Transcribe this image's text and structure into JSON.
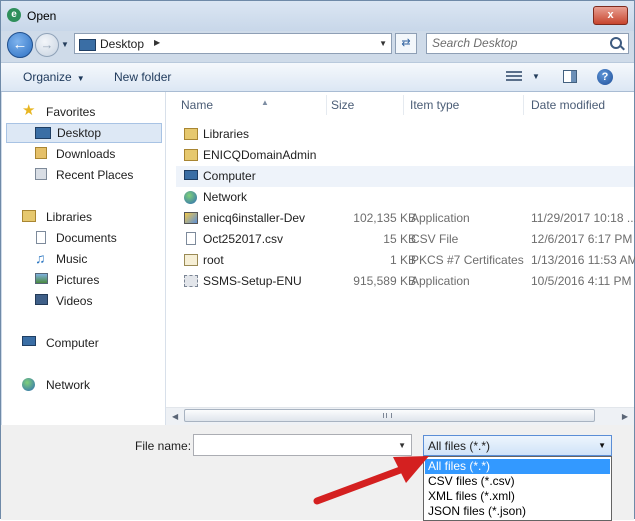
{
  "window": {
    "title": "Open",
    "close_label": "x"
  },
  "address_bar": {
    "location": "Desktop"
  },
  "search": {
    "placeholder": "Search Desktop"
  },
  "toolbar": {
    "organize_label": "Organize",
    "new_folder_label": "New folder"
  },
  "nav_pane": {
    "favorites": {
      "label": "Favorites",
      "items": [
        {
          "label": "Desktop",
          "icon": "desktop-icon",
          "selected": true
        },
        {
          "label": "Downloads",
          "icon": "downloads-icon"
        },
        {
          "label": "Recent Places",
          "icon": "recent-places-icon"
        }
      ]
    },
    "libraries": {
      "label": "Libraries",
      "items": [
        {
          "label": "Documents",
          "icon": "documents-icon"
        },
        {
          "label": "Music",
          "icon": "music-icon"
        },
        {
          "label": "Pictures",
          "icon": "pictures-icon"
        },
        {
          "label": "Videos",
          "icon": "videos-icon"
        }
      ]
    },
    "computer": {
      "label": "Computer"
    },
    "network": {
      "label": "Network"
    }
  },
  "columns": {
    "name": "Name",
    "size": "Size",
    "type": "Item type",
    "date": "Date modified"
  },
  "files": [
    {
      "name": "Libraries",
      "size": "",
      "type": "",
      "date": "",
      "icon": "folder-icon"
    },
    {
      "name": "ENICQDomainAdmin",
      "size": "",
      "type": "",
      "date": "",
      "icon": "user-folder-icon"
    },
    {
      "name": "Computer",
      "size": "",
      "type": "",
      "date": "",
      "icon": "computer-icon"
    },
    {
      "name": "Network",
      "size": "",
      "type": "",
      "date": "",
      "icon": "network-icon"
    },
    {
      "name": "enicq6installer-Dev",
      "size": "102,135 KB",
      "type": "Application",
      "date": "11/29/2017 10:18 ...",
      "icon": "installer-icon"
    },
    {
      "name": "Oct252017.csv",
      "size": "15 KB",
      "type": "CSV File",
      "date": "12/6/2017 6:17 PM",
      "icon": "csv-file-icon"
    },
    {
      "name": "root",
      "size": "1 KB",
      "type": "PKCS #7 Certificates",
      "date": "1/13/2016 11:53 AM",
      "icon": "certificate-icon"
    },
    {
      "name": "SSMS-Setup-ENU",
      "size": "915,589 KB",
      "type": "Application",
      "date": "10/5/2016 4:11 PM",
      "icon": "setup-icon"
    }
  ],
  "bottom": {
    "file_name_label": "File name:",
    "file_name_value": "",
    "filter_selected": "All files (*.*)",
    "filter_options": [
      "All files (*.*)",
      "CSV files (*.csv)",
      "XML files (*.xml)",
      "JSON files (*.json)"
    ]
  },
  "colors": {
    "selection": "#3399ff",
    "annotation_arrow": "#d42020",
    "window_frame": "#cfdbe9"
  }
}
